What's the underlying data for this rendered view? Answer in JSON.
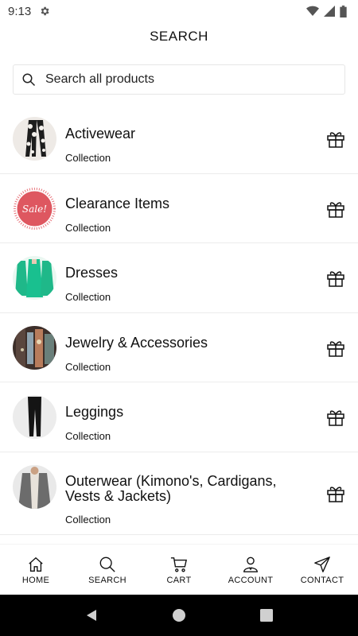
{
  "status_bar": {
    "time": "9:13"
  },
  "header": {
    "title": "SEARCH"
  },
  "search": {
    "placeholder": "Search all products"
  },
  "collections": [
    {
      "title": "Activewear",
      "subtitle": "Collection"
    },
    {
      "title": "Clearance Items",
      "subtitle": "Collection",
      "thumb_text": "Sale!"
    },
    {
      "title": "Dresses",
      "subtitle": "Collection"
    },
    {
      "title": "Jewelry & Accessories",
      "subtitle": "Collection"
    },
    {
      "title": "Leggings",
      "subtitle": "Collection"
    },
    {
      "title": "Outerwear (Kimono's, Cardigans, Vests & Jackets)",
      "subtitle": "Collection"
    }
  ],
  "bottom_nav": [
    {
      "label": "HOME",
      "icon": "home-icon"
    },
    {
      "label": "SEARCH",
      "icon": "search-icon"
    },
    {
      "label": "CART",
      "icon": "cart-icon"
    },
    {
      "label": "ACCOUNT",
      "icon": "account-icon"
    },
    {
      "label": "CONTACT",
      "icon": "send-icon"
    }
  ],
  "colors": {
    "accent": "#111111",
    "divider": "#ececec",
    "sale_red": "#c8202a",
    "dress_green": "#1fb889"
  }
}
